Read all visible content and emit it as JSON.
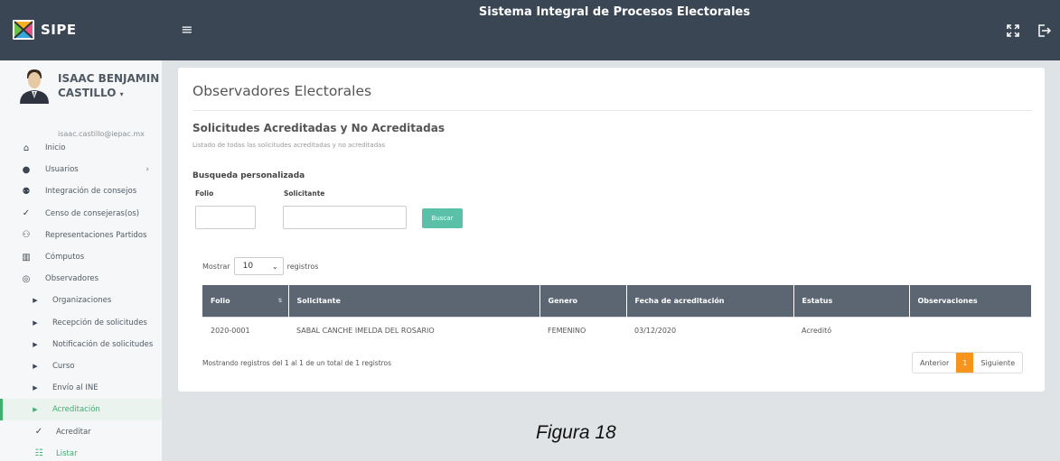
{
  "header": {
    "brand": "SIPE",
    "app_title": "Sistema Integral de Procesos Electorales",
    "menu_icon": "hamburger-icon",
    "fullscreen_icon": "fullscreen-icon",
    "logout_icon": "logout-icon"
  },
  "user": {
    "name_line1": "ISAAC BENJAMIN",
    "name_line2": "CASTILLO",
    "email": "isaac.castillo@iepac.mx"
  },
  "sidebar": {
    "items": [
      {
        "label": "Inicio",
        "icon": "home-icon"
      },
      {
        "label": "Usuarios",
        "icon": "user-icon"
      },
      {
        "label": "Integración de consejos",
        "icon": "group-icon"
      },
      {
        "label": "Censo de consejeras(os)",
        "icon": "check-icon"
      },
      {
        "label": "Representaciones Partidos",
        "icon": "people-icon"
      },
      {
        "label": "Cómputos",
        "icon": "bar-chart-icon"
      },
      {
        "label": "Observadores",
        "icon": "eye-icon"
      },
      {
        "label": "Organizaciones",
        "icon": "caret-right-icon"
      },
      {
        "label": "Recepción de solicitudes",
        "icon": "caret-right-icon"
      },
      {
        "label": "Notificación de solicitudes",
        "icon": "caret-right-icon"
      },
      {
        "label": "Curso",
        "icon": "caret-right-icon"
      },
      {
        "label": "Envío al INE",
        "icon": "caret-right-icon"
      },
      {
        "label": "Acreditación",
        "icon": "caret-right-icon"
      },
      {
        "label": "Acreditar",
        "icon": "check-icon"
      },
      {
        "label": "Listar",
        "icon": "list-icon"
      }
    ]
  },
  "main": {
    "page_title": "Observadores Electorales",
    "section_title": "Solicitudes Acreditadas y No Acreditadas",
    "section_subtitle": "Listado de todas las solicitudes acreditadas y no acreditadas",
    "search": {
      "title": "Busqueda personalizada",
      "folio_label": "Folio",
      "solicitante_label": "Solicitante",
      "button_label": "Buscar"
    },
    "length_menu": {
      "prefix": "Mostrar",
      "value": "10",
      "suffix": "registros"
    },
    "table": {
      "columns": [
        "Folio",
        "Solicitante",
        "Genero",
        "Fecha de acreditación",
        "Estatus",
        "Observaciones"
      ],
      "rows": [
        [
          "2020-0001",
          "SABAL CANCHE IMELDA DEL ROSARIO",
          "FEMENINO",
          "03/12/2020",
          "Acreditó",
          ""
        ]
      ]
    },
    "info": "Mostrando registros del 1 al 1 de un total de 1 registros",
    "pagination": {
      "prev": "Anterior",
      "current": "1",
      "next": "Siguiente"
    }
  },
  "caption": "Figura 18",
  "colors": {
    "header_bg": "#3b4654",
    "accent_green": "#3fae6f",
    "table_header": "#5b6672",
    "button": "#5bc0a8",
    "page_active": "#f7941d"
  }
}
